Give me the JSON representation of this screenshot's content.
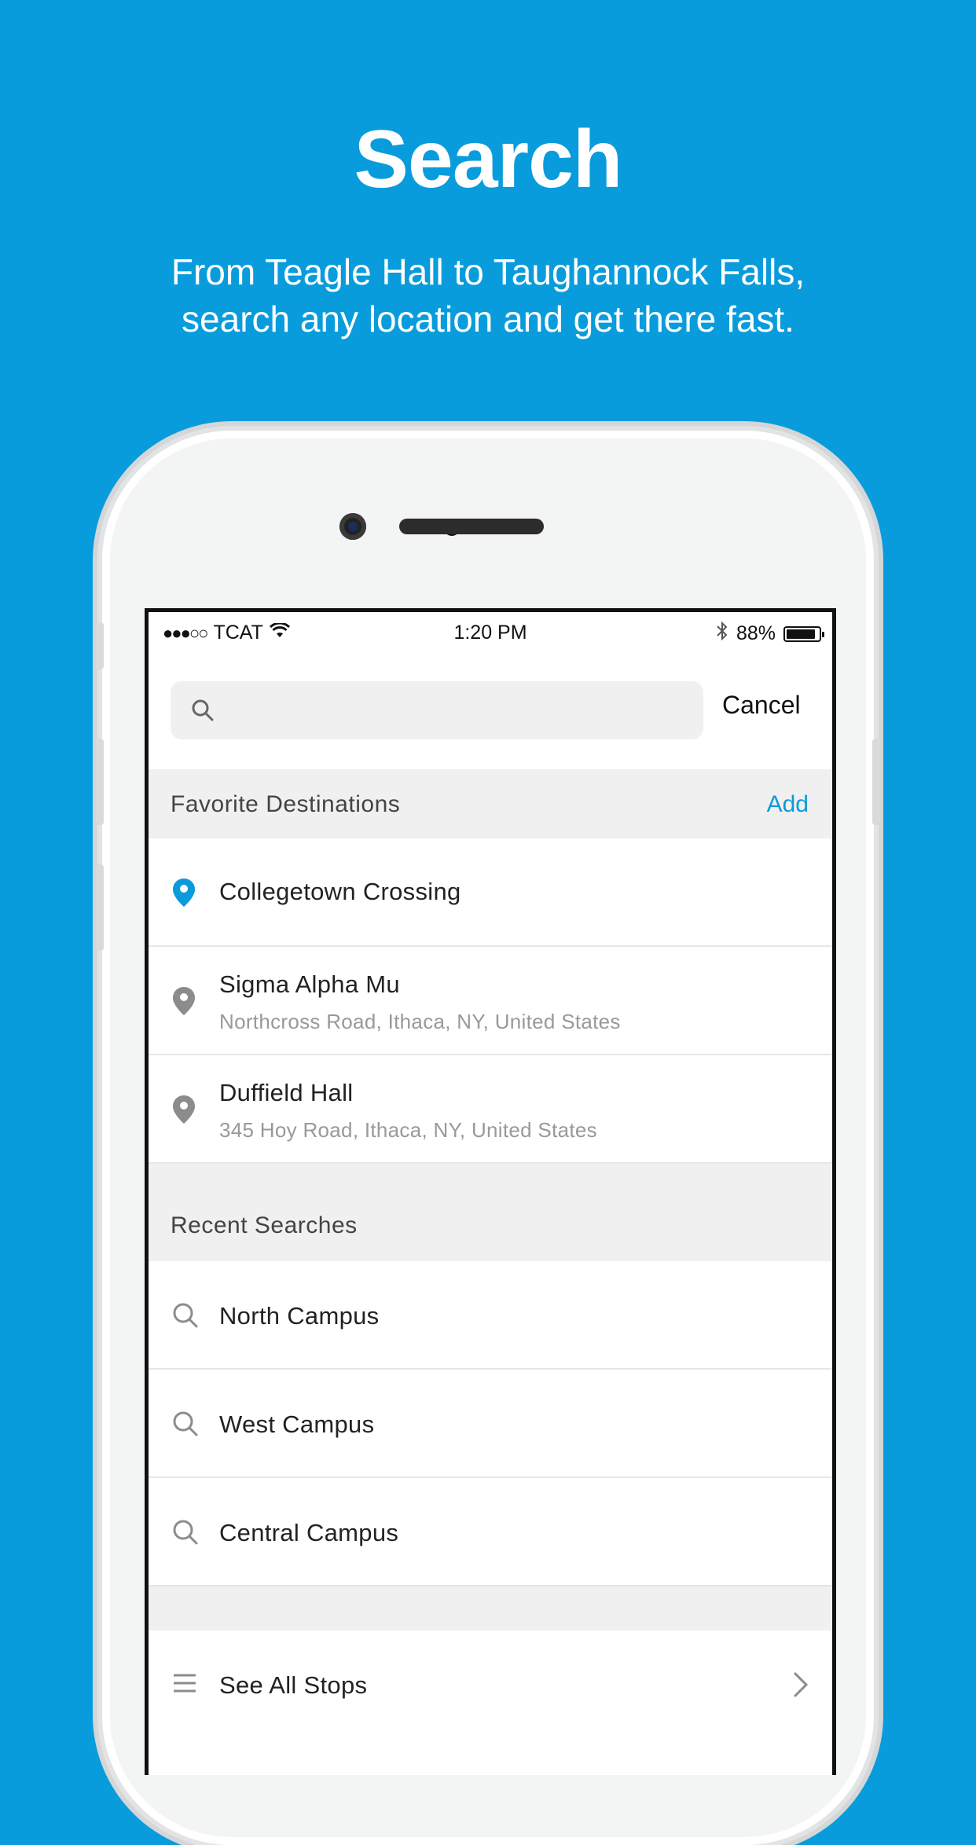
{
  "hero": {
    "title": "Search",
    "subtitle_line1": "From Teagle Hall to Taughannock Falls,",
    "subtitle_line2": "search any location and get there fast."
  },
  "status_bar": {
    "signal": "●●●○○",
    "carrier": "TCAT",
    "time": "1:20 PM",
    "battery_percent": "88%",
    "battery_level": 0.88
  },
  "search": {
    "placeholder": "",
    "cancel_label": "Cancel"
  },
  "favorites": {
    "header": "Favorite Destinations",
    "add_label": "Add",
    "items": [
      {
        "name": "Collegetown Crossing",
        "address": ""
      },
      {
        "name": "Sigma Alpha Mu",
        "address": "Northcross Road, Ithaca, NY, United States"
      },
      {
        "name": "Duffield Hall",
        "address": "345 Hoy Road, Ithaca, NY, United States"
      }
    ]
  },
  "recent": {
    "header": "Recent Searches",
    "items": [
      {
        "name": "North Campus"
      },
      {
        "name": "West Campus"
      },
      {
        "name": "Central Campus"
      }
    ]
  },
  "see_all": {
    "label": "See All Stops"
  },
  "colors": {
    "background": "#099cdc",
    "accent": "#0a9bdc",
    "pin_active": "#0a9bdc",
    "pin_inactive": "#8c8c8c"
  }
}
